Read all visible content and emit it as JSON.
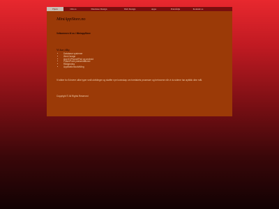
{
  "nav": {
    "items": [
      {
        "label": "Hjem",
        "active": true
      },
      {
        "label": "Om os",
        "active": false
      },
      {
        "label": "Database Design",
        "active": false
      },
      {
        "label": "Web Design",
        "active": false
      },
      {
        "label": "Apps",
        "active": false
      },
      {
        "label": "Portefølje",
        "active": false
      },
      {
        "label": "Kontakt os",
        "active": false
      }
    ]
  },
  "header": {
    "logo_text": "MiniAppStore.no"
  },
  "main": {
    "welcome": "Velkommen til os i MiniappStore",
    "services_heading": "Vi kan tilby",
    "services": [
      "Database systemer",
      "Web Design",
      "App til iPhone/iPad og android",
      "PowerPoint præsentationer",
      "Rådgivning",
      "Applikationsudvikling"
    ],
    "intro": "Vi sikter for å levere ulike typer små utviklinger og skaffer nye kunnskap om foretakets prosesser og behovene når vi du sidene har øyblikk dine mål.",
    "copyright": "Copyright © All Rights Reserved"
  },
  "colors": {
    "page_bg": "#9b3a07",
    "nav_bg": "#7a0e0e",
    "nav_active_bg": "#c9bfb6",
    "body_gradient_top": "#e8282e",
    "body_gradient_bottom": "#120203"
  }
}
